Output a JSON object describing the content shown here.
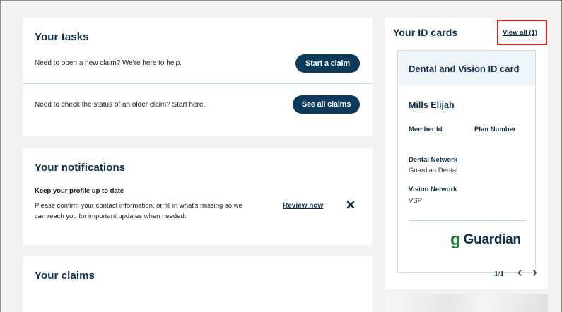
{
  "tasks": {
    "title": "Your tasks",
    "rows": [
      {
        "text": "Need to open a new claim? We're here to help.",
        "button": "Start a claim"
      },
      {
        "text": "Need to check the status of an older claim? Start here.",
        "button": "See all claims"
      }
    ]
  },
  "notifications": {
    "title": "Your notifications",
    "item_title": "Keep your profile up to date",
    "item_line1": "Please confirm your contact information, or fill in what's missing so we",
    "item_line2": "can reach you for important updates when needed.",
    "action_label": "Review now",
    "close_icon": "close-icon"
  },
  "claims": {
    "title": "Your claims"
  },
  "id_cards": {
    "title": "Your ID cards",
    "view_all_label": "View all (1)",
    "card": {
      "header": "Dental and Vision ID card",
      "member_name": "Mills Elijah",
      "member_id_label": "Member Id",
      "plan_number_label": "Plan Number",
      "dental_network_label": "Dental Network",
      "dental_network_value": "Guardian Dental",
      "vision_network_label": "Vision Network",
      "vision_network_value": "VSP",
      "brand": "Guardian",
      "brand_mark": "g"
    },
    "pager": "1/1",
    "prev_glyph": "‹",
    "next_glyph": "›"
  },
  "colors": {
    "navy": "#0b2d4f",
    "button": "#0b3a5b",
    "brand_green": "#1b7f3a",
    "highlight": "#e02020",
    "background": "#f2f2f2"
  }
}
